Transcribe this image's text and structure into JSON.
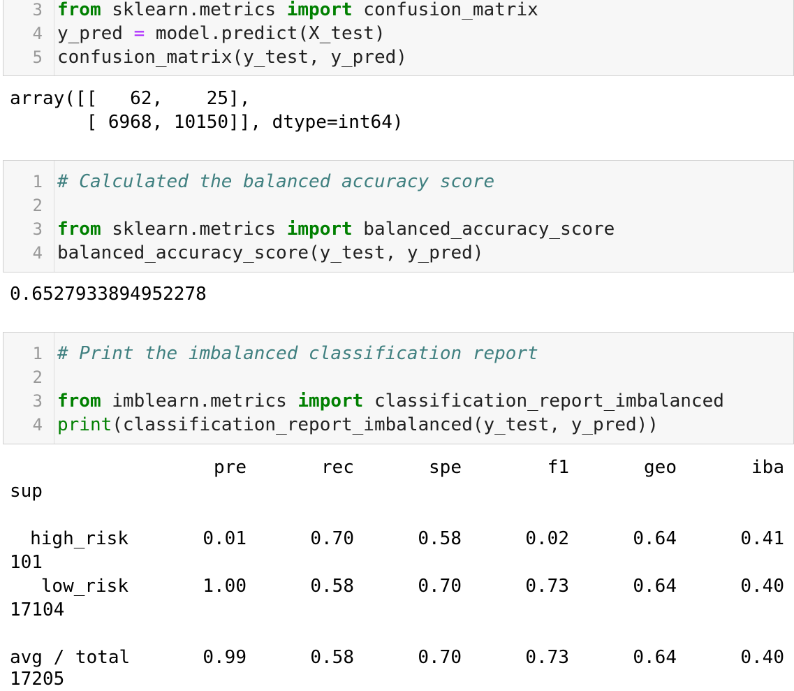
{
  "cell_a": {
    "lines": [
      {
        "num": "3",
        "kw1": "from",
        "mid": " sklearn.metrics ",
        "kw2": "import",
        "rest": " confusion_matrix"
      },
      {
        "num": "4",
        "pre": "y_pred ",
        "op": "=",
        "post": " model.predict(X_test)"
      },
      {
        "num": "5",
        "text": "confusion_matrix(y_test, y_pred)"
      }
    ]
  },
  "output_a": {
    "line1": "array([[   62,    25],",
    "line2": "       [ 6968, 10150]], dtype=int64)"
  },
  "cell_b": {
    "lines": [
      {
        "num": "1",
        "comment": "# Calculated the balanced accuracy score"
      },
      {
        "num": "2"
      },
      {
        "num": "3",
        "kw1": "from",
        "mid": " sklearn.metrics ",
        "kw2": "import",
        "rest": " balanced_accuracy_score"
      },
      {
        "num": "4",
        "text": "balanced_accuracy_score(y_test, y_pred)"
      }
    ]
  },
  "output_b": {
    "value": "0.6527933894952278"
  },
  "cell_c": {
    "lines": [
      {
        "num": "1",
        "comment": "# Print the imbalanced classification report"
      },
      {
        "num": "2"
      },
      {
        "num": "3",
        "kw1": "from",
        "mid": " imblearn.metrics ",
        "kw2": "import",
        "rest": " classification_report_imbalanced"
      },
      {
        "num": "4",
        "builtin": "print",
        "rest": "(classification_report_imbalanced(y_test, y_pred))"
      }
    ]
  },
  "report": {
    "headers": [
      "pre",
      "rec",
      "spe",
      "f1",
      "geo",
      "iba",
      "sup"
    ],
    "rows": [
      {
        "label": "high_risk",
        "values": [
          "0.01",
          "0.70",
          "0.58",
          "0.02",
          "0.64",
          "0.41"
        ],
        "sup": "101"
      },
      {
        "label": "low_risk",
        "values": [
          "1.00",
          "0.58",
          "0.70",
          "0.73",
          "0.64",
          "0.40"
        ],
        "sup": "17104"
      },
      {
        "label": "avg / total",
        "values": [
          "0.99",
          "0.58",
          "0.70",
          "0.73",
          "0.64",
          "0.40"
        ],
        "sup": "17205"
      }
    ]
  }
}
